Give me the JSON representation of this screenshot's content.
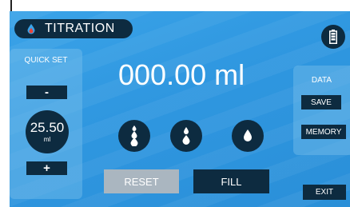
{
  "header": {
    "title": "TITRATION",
    "title_icon": "water-drop-icon",
    "battery_icon": "battery-icon"
  },
  "quick_set": {
    "label": "QUICK SET",
    "minus_label": "-",
    "plus_label": "+",
    "value": "25.50",
    "unit": "ml"
  },
  "readout": {
    "value": "000.00 ml"
  },
  "drop_buttons": [
    {
      "icon": "three-drops-icon"
    },
    {
      "icon": "two-drops-icon"
    },
    {
      "icon": "single-drop-icon"
    }
  ],
  "actions": {
    "reset_label": "RESET",
    "fill_label": "FILL"
  },
  "data_panel": {
    "label": "DATA",
    "save_label": "SAVE",
    "memory_label": "MEMORY"
  },
  "exit_label": "EXIT",
  "colors": {
    "background": "#2f97e0",
    "button": "#0d2b40",
    "disabled": "#aab6c0",
    "accent_red": "#e8443a"
  }
}
